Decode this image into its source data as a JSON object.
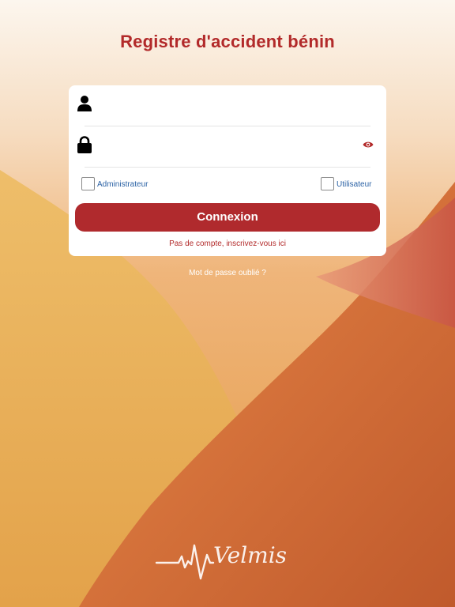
{
  "status_bar": {
    "left_text": "",
    "right_text": ""
  },
  "app": {
    "title": "Registre d'accident bénin"
  },
  "form": {
    "username": {
      "value": "",
      "placeholder": ""
    },
    "password": {
      "value": "",
      "placeholder": ""
    },
    "roles": [
      {
        "label": "Administrateur",
        "checked": false
      },
      {
        "label": "Utilisateur",
        "checked": false
      }
    ],
    "login_label": "Connexion",
    "signup_label": "Pas de compte, inscrivez-vous ici"
  },
  "forgot_password_label": "Mot de passe oublié ?",
  "brand": {
    "logo_text": "Velmis"
  },
  "colors": {
    "accent": "#b22a2a",
    "button": "#b02a2d",
    "link": "#2b62a5",
    "background_top": "#fbf3e8",
    "background_mid": "#e8a24e",
    "background_bottom": "#c2602c"
  },
  "icons": {
    "username": "user-icon",
    "password": "lock-icon",
    "show_password": "eye-icon"
  }
}
